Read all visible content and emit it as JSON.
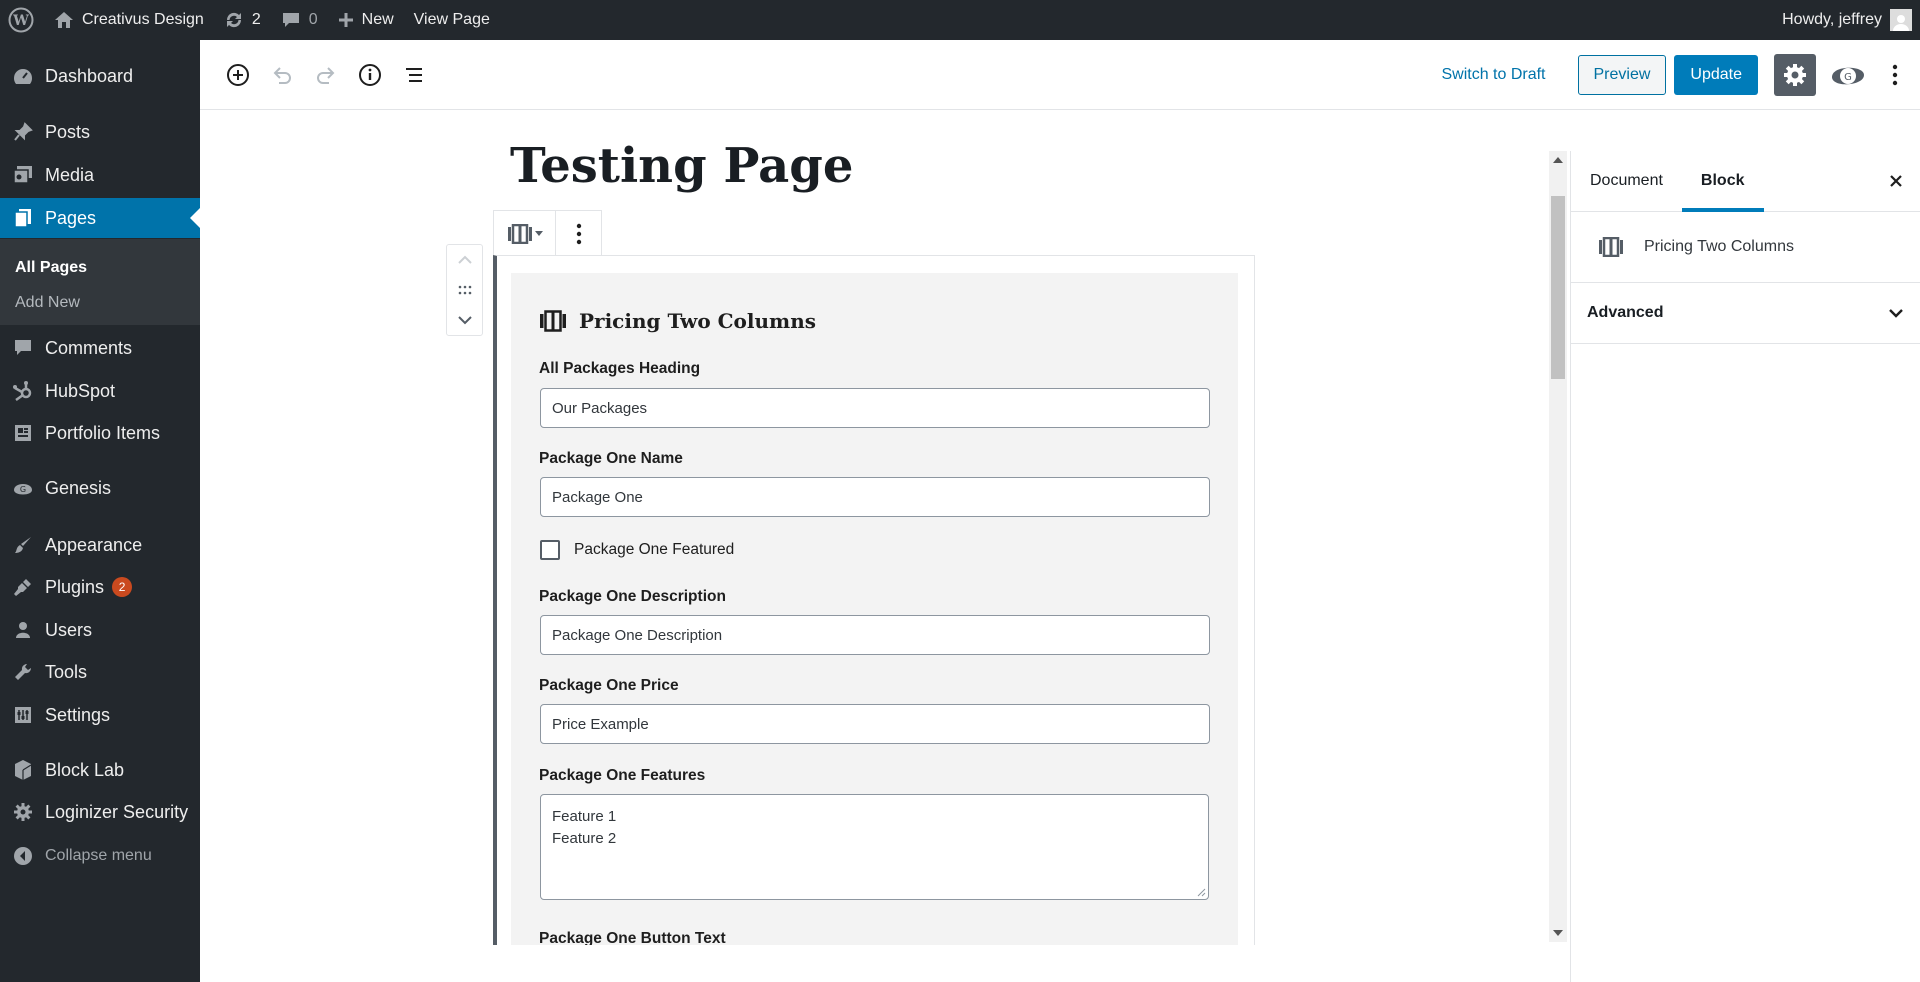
{
  "adminbar": {
    "site_name": "Creativus Design",
    "updates_count": "2",
    "comments_count": "0",
    "new_label": "New",
    "view_page_label": "View Page",
    "howdy": "Howdy, jeffrey"
  },
  "sidebar": {
    "dashboard": "Dashboard",
    "posts": "Posts",
    "media": "Media",
    "pages": "Pages",
    "all_pages": "All Pages",
    "add_new": "Add New",
    "comments": "Comments",
    "hubspot": "HubSpot",
    "portfolio": "Portfolio Items",
    "genesis": "Genesis",
    "appearance": "Appearance",
    "plugins": "Plugins",
    "plugins_badge": "2",
    "users": "Users",
    "tools": "Tools",
    "settings": "Settings",
    "block_lab": "Block Lab",
    "loginizer": "Loginizer Security",
    "collapse": "Collapse menu"
  },
  "toolbar": {
    "switch_to_draft": "Switch to Draft",
    "preview": "Preview",
    "update": "Update"
  },
  "editor": {
    "page_title": "Testing Page",
    "block_title": "Pricing Two Columns",
    "fields": {
      "all_packages_heading_label": "All Packages Heading",
      "all_packages_heading_value": "Our Packages",
      "package_one_name_label": "Package One Name",
      "package_one_name_value": "Package One",
      "package_one_featured_label": "Package One Featured",
      "package_one_description_label": "Package One Description",
      "package_one_description_value": "Package One Description",
      "package_one_price_label": "Package One Price",
      "package_one_price_value": "Price Example",
      "package_one_features_label": "Package One Features",
      "package_one_features_line1": "Feature 1",
      "package_one_features_line2": "Feature 2",
      "package_one_button_text_label": "Package One Button Text"
    }
  },
  "settings_panel": {
    "tab_document": "Document",
    "tab_block": "Block",
    "block_name": "Pricing Two Columns",
    "advanced": "Advanced"
  },
  "colors": {
    "admin_dark": "#23282d",
    "accent_blue": "#0073aa",
    "badge_orange": "#ca4a1f"
  }
}
